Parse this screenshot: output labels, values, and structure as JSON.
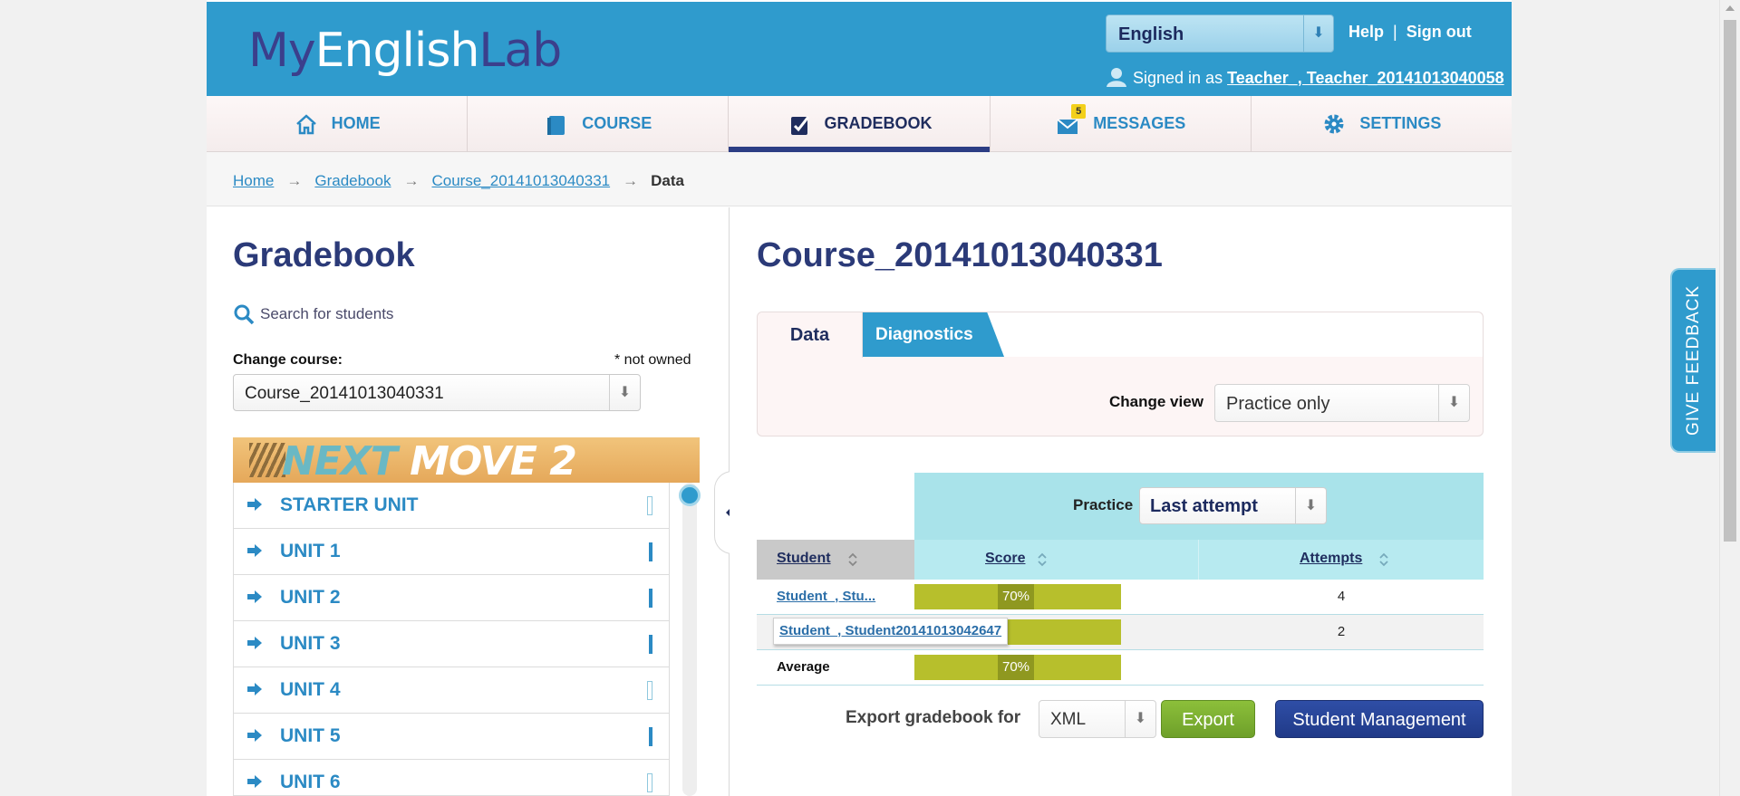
{
  "header": {
    "logo_my": "My",
    "logo_english": "English",
    "logo_lab": "Lab",
    "language": "English",
    "help": "Help",
    "separator": "|",
    "signout": "Sign out",
    "signed_in_prefix": "Signed in as",
    "signed_in_user": "Teacher_, Teacher_20141013040058"
  },
  "nav": {
    "items": [
      {
        "label": "HOME",
        "icon": "home-icon"
      },
      {
        "label": "COURSE",
        "icon": "book-icon"
      },
      {
        "label": "GRADEBOOK",
        "icon": "gradebook-check-icon"
      },
      {
        "label": "MESSAGES",
        "icon": "envelope-icon",
        "badge": "5"
      },
      {
        "label": "SETTINGS",
        "icon": "gear-icon"
      }
    ],
    "active": "GRADEBOOK"
  },
  "breadcrumb": {
    "items": [
      "Home",
      "Gradebook",
      "Course_20141013040331"
    ],
    "arrow": "→",
    "current": "Data"
  },
  "left": {
    "title": "Gradebook",
    "search_label": "Search for students",
    "change_course_label": "Change course:",
    "not_owned": "* not owned",
    "course": "Course_20141013040331",
    "banner_next": "NEXT",
    "banner_move": " MOVE 2",
    "units": [
      {
        "label": "STARTER UNIT",
        "bar": "empty"
      },
      {
        "label": "UNIT 1",
        "bar": "filled"
      },
      {
        "label": "UNIT 2",
        "bar": "filled"
      },
      {
        "label": "UNIT 3",
        "bar": "filled"
      },
      {
        "label": "UNIT 4",
        "bar": "empty"
      },
      {
        "label": "UNIT 5",
        "bar": "filled"
      },
      {
        "label": "UNIT 6",
        "bar": "empty"
      }
    ]
  },
  "right": {
    "title": "Course_20141013040331",
    "tab_data": "Data",
    "tab_diagnostics": "Diagnostics",
    "change_view_label": "Change view",
    "change_view_value": "Practice only",
    "practice_label": "Practice",
    "practice_value": "Last attempt",
    "columns": {
      "student": "Student",
      "score": "Score",
      "attempts": "Attempts"
    },
    "rows": [
      {
        "name": "Student_, Stu...",
        "score": "70%",
        "attempts": "4"
      },
      {
        "name": "Student_, Student20141013042647",
        "score": "",
        "attempts": "2"
      },
      {
        "name": "Average",
        "score": "70%",
        "attempts": ""
      }
    ],
    "export_label": "Export gradebook for",
    "export_format": "XML",
    "export_button": "Export",
    "student_management": "Student Management"
  },
  "feedback": "GIVE FEEDBACK",
  "colors": {
    "header_blue": "#2f9bcd",
    "navy": "#2b3a78",
    "score_bar": "#b7bf2c",
    "export_green": "#7db032",
    "sm_blue": "#25418f"
  }
}
